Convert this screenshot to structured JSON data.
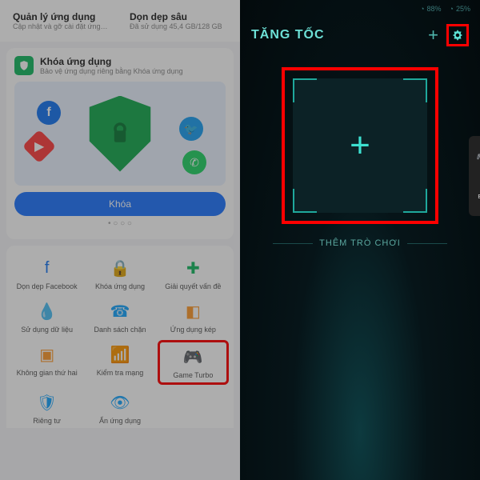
{
  "left": {
    "top_cards": [
      {
        "title": "Quản lý ứng dụng",
        "sub": "Cập nhật và gỡ cài đặt ứng…"
      },
      {
        "title": "Dọn dẹp sâu",
        "sub": "Đã sử dụng 45,4 GB/128 GB"
      }
    ],
    "lock": {
      "title": "Khóa ứng dụng",
      "sub": "Bảo vệ ứng dụng riêng bằng Khóa ứng dụng",
      "button": "Khóa"
    },
    "grid": [
      {
        "label": "Dọn dẹp Facebook",
        "color": "#1877f2",
        "glyph": "f"
      },
      {
        "label": "Khóa ứng dụng",
        "color": "#18ba63",
        "glyph": "🔒"
      },
      {
        "label": "Giải quyết vấn đề",
        "color": "#18ba63",
        "glyph": "✚"
      },
      {
        "label": "Sử dụng dữ liệu",
        "color": "#19a7ff",
        "glyph": "💧"
      },
      {
        "label": "Danh sách chặn",
        "color": "#19a7ff",
        "glyph": "☎"
      },
      {
        "label": "Ứng dụng kép",
        "color": "#ff9b2e",
        "glyph": "◧"
      },
      {
        "label": "Không gian thứ hai",
        "color": "#ff9b2e",
        "glyph": "▣"
      },
      {
        "label": "Kiểm tra mạng",
        "color": "#19a7ff",
        "glyph": "📶"
      },
      {
        "label": "Game Turbo",
        "color": "#9b8cff",
        "glyph": "🎮"
      },
      {
        "label": "Riêng tư",
        "color": "#19a7ff",
        "glyph": "🛡"
      },
      {
        "label": "Ẩn ứng dụng",
        "color": "#19a7ff",
        "glyph": "👁"
      }
    ]
  },
  "right": {
    "status": {
      "battery": "88%",
      "storage": "25%"
    },
    "title": "TĂNG TỐC",
    "add_label": "THÊM TRÒ CHƠI"
  }
}
